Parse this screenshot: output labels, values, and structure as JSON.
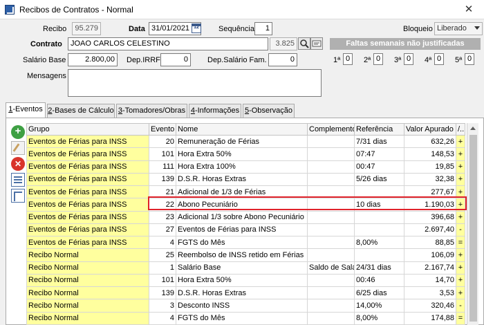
{
  "window": {
    "title": "Recibos de Contratos - Normal",
    "close_glyph": "✕"
  },
  "header": {
    "recibo_label": "Recibo",
    "recibo_value": "95.279",
    "data_label": "Data",
    "data_value": "31/01/2021",
    "calendar_glyph": "12",
    "sequencia_label": "Sequência",
    "sequencia_value": "1",
    "bloqueio_label": "Bloqueio",
    "bloqueio_value": "Liberado",
    "contrato_label": "Contrato",
    "contrato_value": "JOAO CARLOS CELESTINO",
    "contrato_code": "3.825",
    "salario_label": "Salário Base",
    "salario_value": "2.800,00",
    "depirrf_label": "Dep.IRRF",
    "depirrf_value": "0",
    "depsal_label": "Dep.Salário Fam.",
    "depsal_value": "0",
    "mensagens_label": "Mensagens",
    "mensagens_value": "",
    "faltas_banner": "Faltas semanais não justificadas",
    "semanas": [
      {
        "label": "1ª",
        "value": "0"
      },
      {
        "label": "2ª",
        "value": "0"
      },
      {
        "label": "3ª",
        "value": "0"
      },
      {
        "label": "4ª",
        "value": "0"
      },
      {
        "label": "5ª",
        "value": "0"
      }
    ]
  },
  "tabs": [
    {
      "key": "1",
      "rest": "-Eventos"
    },
    {
      "key": "2",
      "rest": "-Bases de Cálculo"
    },
    {
      "key": "3",
      "rest": "-Tomadores/Obras"
    },
    {
      "key": "4",
      "rest": "-Informações"
    },
    {
      "key": "5",
      "rest": "-Observação"
    }
  ],
  "table": {
    "columns": [
      "Grupo",
      "Evento",
      "Nome",
      "Complemento",
      "Referência",
      "Valor Apurado",
      "/.."
    ],
    "rows": [
      [
        "Eventos de Férias para INSS",
        "20",
        "Remuneração de Férias",
        "",
        "7/31 dias",
        "632,26",
        "+"
      ],
      [
        "Eventos de Férias para INSS",
        "101",
        "Hora Extra 50%",
        "",
        "07:47",
        "148,53",
        "+"
      ],
      [
        "Eventos de Férias para INSS",
        "111",
        "Hora Extra 100%",
        "",
        "00:47",
        "19,85",
        "+"
      ],
      [
        "Eventos de Férias para INSS",
        "139",
        "D.S.R. Horas Extras",
        "",
        "5/26 dias",
        "32,38",
        "+"
      ],
      [
        "Eventos de Férias para INSS",
        "21",
        "Adicional de 1/3 de Férias",
        "",
        "",
        "277,67",
        "+"
      ],
      [
        "Eventos de Férias para INSS",
        "22",
        "Abono Pecuniário",
        "",
        "10 dias",
        "1.190,03",
        "+"
      ],
      [
        "Eventos de Férias para INSS",
        "23",
        "Adicional 1/3 sobre Abono Pecuniário",
        "",
        "",
        "396,68",
        "+"
      ],
      [
        "Eventos de Férias para INSS",
        "27",
        "Eventos de Férias para INSS",
        "",
        "",
        "2.697,40",
        "-"
      ],
      [
        "Eventos de Férias para INSS",
        "4",
        "FGTS do Mês",
        "",
        "8,00%",
        "88,85",
        "="
      ],
      [
        "Recibo Normal",
        "25",
        "Reembolso de INSS retido em Férias",
        "",
        "",
        "106,09",
        "+"
      ],
      [
        "Recibo Normal",
        "1",
        "Salário Base",
        "Saldo de Salá",
        "24/31 dias",
        "2.167,74",
        "+"
      ],
      [
        "Recibo Normal",
        "101",
        "Hora Extra 50%",
        "",
        "00:46",
        "14,70",
        "+"
      ],
      [
        "Recibo Normal",
        "139",
        "D.S.R. Horas Extras",
        "",
        "6/25 dias",
        "3,53",
        "+"
      ],
      [
        "Recibo Normal",
        "3",
        "Desconto INSS",
        "",
        "14,00%",
        "320,46",
        "-"
      ],
      [
        "Recibo Normal",
        "4",
        "FGTS do Mês",
        "",
        "8,00%",
        "174,88",
        "="
      ]
    ]
  },
  "toolbar": {
    "add_glyph": "+",
    "delete_glyph": "✕"
  }
}
